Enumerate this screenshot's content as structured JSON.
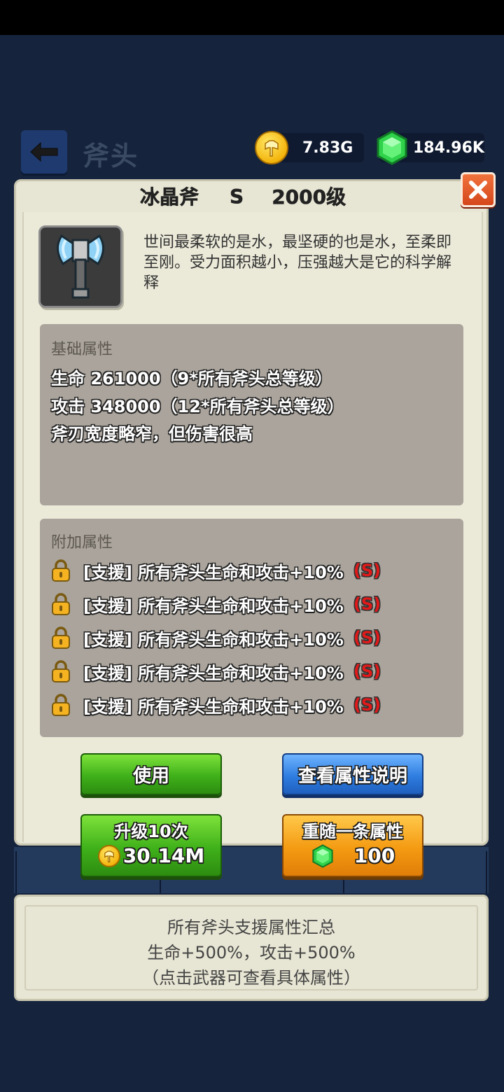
{
  "header": {
    "title": "斧头",
    "gold": "7.83G",
    "gems": "184.96K"
  },
  "item": {
    "name": "冰晶斧",
    "grade": "S",
    "level": "2000级",
    "description": "世间最柔软的是水，最坚硬的也是水，至柔即至刚。受力面积越小，压强越大是它的科学解释"
  },
  "base_attributes": {
    "heading": "基础属性",
    "lines": [
      "生命 261000（9*所有斧头总等级）",
      "攻击 348000（12*所有斧头总等级）",
      "斧刃宽度略窄，但伤害很高"
    ]
  },
  "extra_attributes": {
    "heading": "附加属性",
    "rows": [
      {
        "text": "[支援] 所有斧头生命和攻击+10%",
        "grade": "(S)"
      },
      {
        "text": "[支援] 所有斧头生命和攻击+10%",
        "grade": "(S)"
      },
      {
        "text": "[支援] 所有斧头生命和攻击+10%",
        "grade": "(S)"
      },
      {
        "text": "[支援] 所有斧头生命和攻击+10%",
        "grade": "(S)"
      },
      {
        "text": "[支援] 所有斧头生命和攻击+10%",
        "grade": "(S)"
      }
    ]
  },
  "buttons": {
    "use": "使用",
    "view_attr": "查看属性说明",
    "upgrade_label": "升级10次",
    "upgrade_cost": "30.14M",
    "reroll_label": "重随一条属性",
    "reroll_cost": "100"
  },
  "summary": {
    "line1": "所有斧头支援属性汇总",
    "line2": "生命+500%，攻击+500%",
    "line3": "（点击武器可查看具体属性）"
  },
  "colors": {
    "accent_green": "#3fb01a",
    "accent_blue": "#2e7de0",
    "accent_orange": "#f49a12",
    "grade_red": "#e01a1a"
  }
}
